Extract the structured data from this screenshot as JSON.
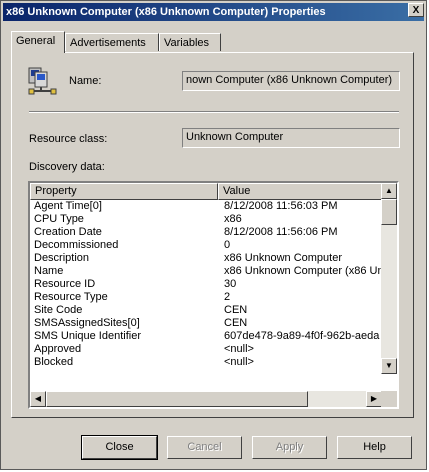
{
  "window": {
    "title": "x86 Unknown Computer (x86 Unknown Computer) Properties",
    "close_glyph": "X"
  },
  "tabs": [
    {
      "label": "General",
      "active": true
    },
    {
      "label": "Advertisements",
      "active": false
    },
    {
      "label": "Variables",
      "active": false
    }
  ],
  "general": {
    "icon": "computers-network-icon",
    "name_label": "Name:",
    "name_value": "nown Computer (x86 Unknown Computer)",
    "resource_class_label": "Resource class:",
    "resource_class_value": "Unknown Computer",
    "discovery_label": "Discovery data:"
  },
  "discovery": {
    "columns": [
      "Property",
      "Value"
    ],
    "rows": [
      {
        "property": "Agent Time[0]",
        "value": "8/12/2008 11:56:03 PM"
      },
      {
        "property": "CPU Type",
        "value": "x86"
      },
      {
        "property": "Creation Date",
        "value": "8/12/2008 11:56:06 PM"
      },
      {
        "property": "Decommissioned",
        "value": "0"
      },
      {
        "property": "Description",
        "value": "x86 Unknown Computer"
      },
      {
        "property": "Name",
        "value": "x86 Unknown Computer (x86 Un"
      },
      {
        "property": "Resource ID",
        "value": "30"
      },
      {
        "property": "Resource Type",
        "value": "2"
      },
      {
        "property": "Site Code",
        "value": "CEN"
      },
      {
        "property": "SMSAssignedSites[0]",
        "value": "CEN"
      },
      {
        "property": "SMS Unique Identifier",
        "value": "607de478-9a89-4f0f-962b-aeda"
      },
      {
        "property": "Approved",
        "value": "<null>"
      },
      {
        "property": "Blocked",
        "value": "<null>"
      }
    ]
  },
  "buttons": {
    "close": "Close",
    "cancel": "Cancel",
    "apply": "Apply",
    "help": "Help"
  }
}
